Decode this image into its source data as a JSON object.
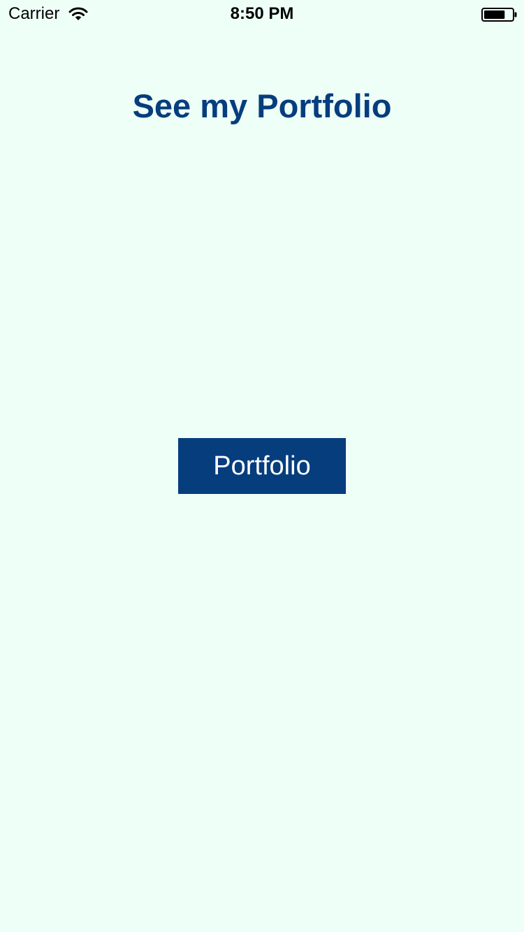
{
  "status_bar": {
    "carrier": "Carrier",
    "time": "8:50 PM",
    "wifi_icon": "wifi-icon",
    "battery_icon": "battery-icon",
    "battery_level": 0.75
  },
  "main": {
    "title": "See my Portfolio",
    "portfolio_button_label": "Portfolio"
  },
  "colors": {
    "background": "#eefff8",
    "brand": "#063d7d",
    "button_text": "#ffffff"
  }
}
